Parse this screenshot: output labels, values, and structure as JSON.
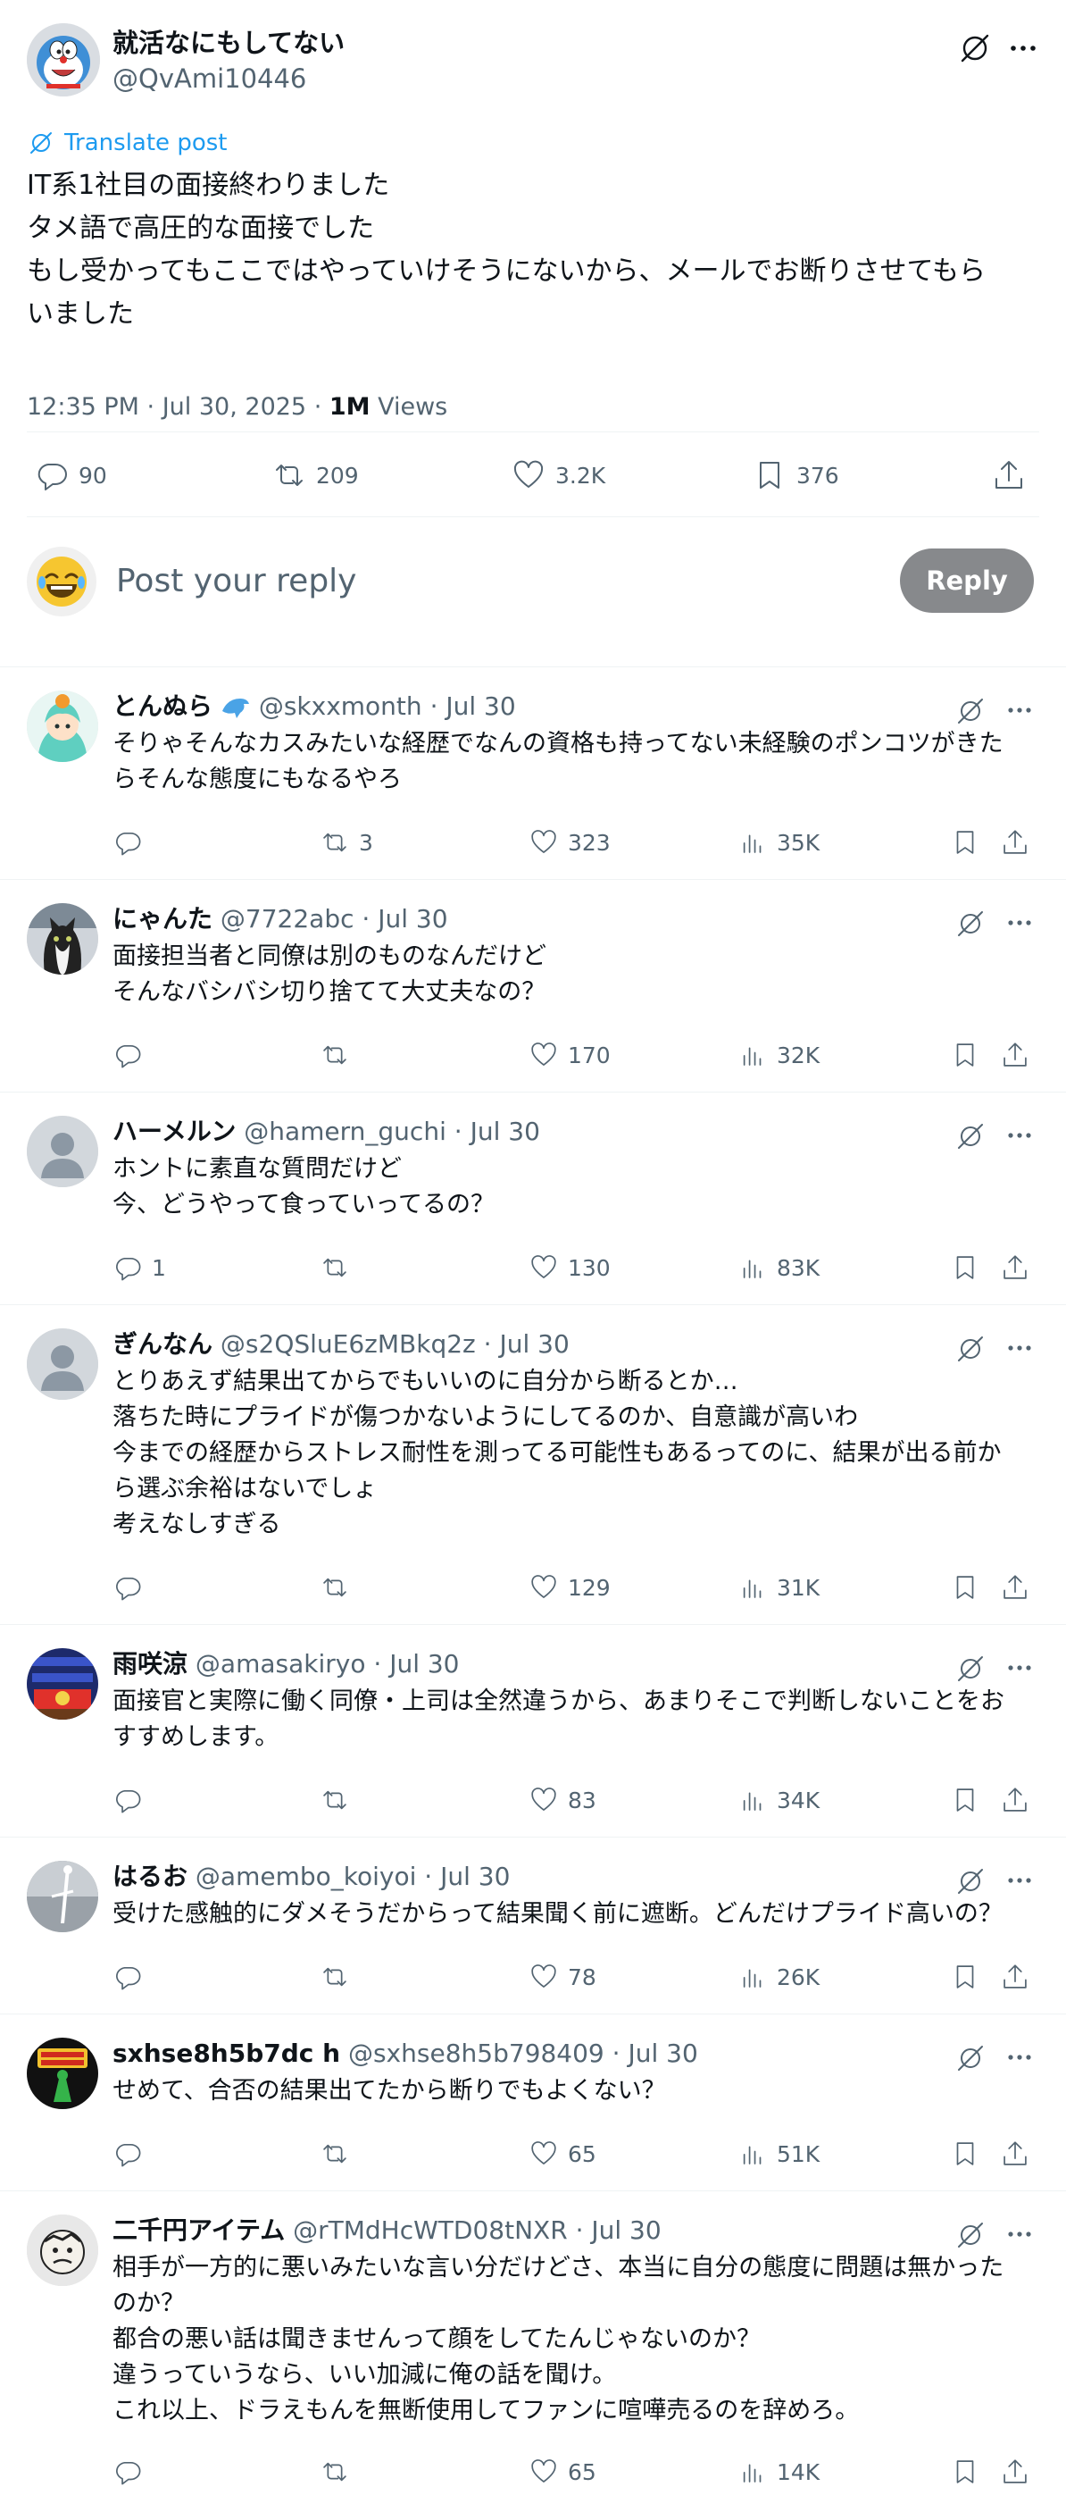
{
  "colors": {
    "accent": "#1d9bf0",
    "text": "#0f1419",
    "secondary": "#536471",
    "reply_button": "#87898c"
  },
  "post": {
    "author_name": "就活なにもしてない",
    "author_handle": "@QvAmi10446",
    "translate_label": "Translate post",
    "text_lines": [
      "IT系1社目の面接終わりました",
      "タメ語で高圧的な面接でした",
      "もし受かってもここではやっていけそうにないから、メールでお断りさせてもら",
      "いました"
    ],
    "time": "12:35 PM · Jul 30, 2025 · ",
    "views_count": "1M",
    "views_label": " Views",
    "replies": "90",
    "reposts": "209",
    "likes": "3.2K",
    "bookmarks": "376"
  },
  "composer": {
    "placeholder": "Post your reply",
    "button": "Reply"
  },
  "replies": [
    {
      "name": "とんぬら",
      "handle": "@skxxmonth",
      "date": "Jul 30",
      "lines": [
        "そりゃそんなカスみたいな経歴でなんの資格も持ってない未経験のポンコツがきた",
        "らそんな態度にもなるやろ"
      ],
      "replies": "",
      "reposts": "3",
      "likes": "323",
      "views": "35K"
    },
    {
      "name": "にゃんた",
      "handle": "@7722abc",
      "date": "Jul 30",
      "lines": [
        "面接担当者と同僚は別のものなんだけど",
        "そんなバシバシ切り捨てて大丈夫なの？"
      ],
      "replies": "",
      "reposts": "",
      "likes": "170",
      "views": "32K"
    },
    {
      "name": "ハーメルン",
      "handle": "@hamern_guchi",
      "date": "Jul 30",
      "lines": [
        "ホントに素直な質問だけど",
        "今、どうやって食っていってるの？"
      ],
      "replies": "1",
      "reposts": "",
      "likes": "130",
      "views": "83K"
    },
    {
      "name": "ぎんなん",
      "handle": "@s2QSluE6zMBkq2z",
      "date": "Jul 30",
      "lines": [
        "とりあえず結果出てからでもいいのに自分から断るとか…",
        "落ちた時にプライドが傷つかないようにしてるのか、自意識が高いわ",
        "今までの経歴からストレス耐性を測ってる可能性もあるってのに、結果が出る前か",
        "ら選ぶ余裕はないでしょ",
        "考えなしすぎる"
      ],
      "replies": "",
      "reposts": "",
      "likes": "129",
      "views": "31K"
    },
    {
      "name": "雨咲涼",
      "handle": "@amasakiryo",
      "date": "Jul 30",
      "lines": [
        "面接官と実際に働く同僚・上司は全然違うから、あまりそこで判断しないことをお",
        "すすめします。"
      ],
      "replies": "",
      "reposts": "",
      "likes": "83",
      "views": "34K"
    },
    {
      "name": "はるお",
      "handle": "@amembo_koiyoi",
      "date": "Jul 30",
      "lines": [
        "受けた感触的にダメそうだからって結果聞く前に遮断。どんだけプライド高いの？"
      ],
      "replies": "",
      "reposts": "",
      "likes": "78",
      "views": "26K"
    },
    {
      "name": "sxhse8h5b7dc h",
      "handle": "@sxhse8h5b798409",
      "date": "Jul 30",
      "lines": [
        "せめて、合否の結果出てたから断りでもよくない？"
      ],
      "replies": "",
      "reposts": "",
      "likes": "65",
      "views": "51K"
    },
    {
      "name": "二千円アイテム",
      "handle": "@rTMdHcWTD08tNXR",
      "date": "Jul 30",
      "lines": [
        "相手が一方的に悪いみたいな言い分だけどさ、本当に自分の態度に問題は無かった",
        "のか？",
        "都合の悪い話は聞きませんって顔をしてたんじゃないのか？",
        "違うっていうなら、いい加減に俺の話を聞け。",
        "これ以上、ドラえもんを無断使用してファンに喧嘩売るのを辞めろ。"
      ],
      "replies": "",
      "reposts": "",
      "likes": "65",
      "views": "14K"
    }
  ]
}
